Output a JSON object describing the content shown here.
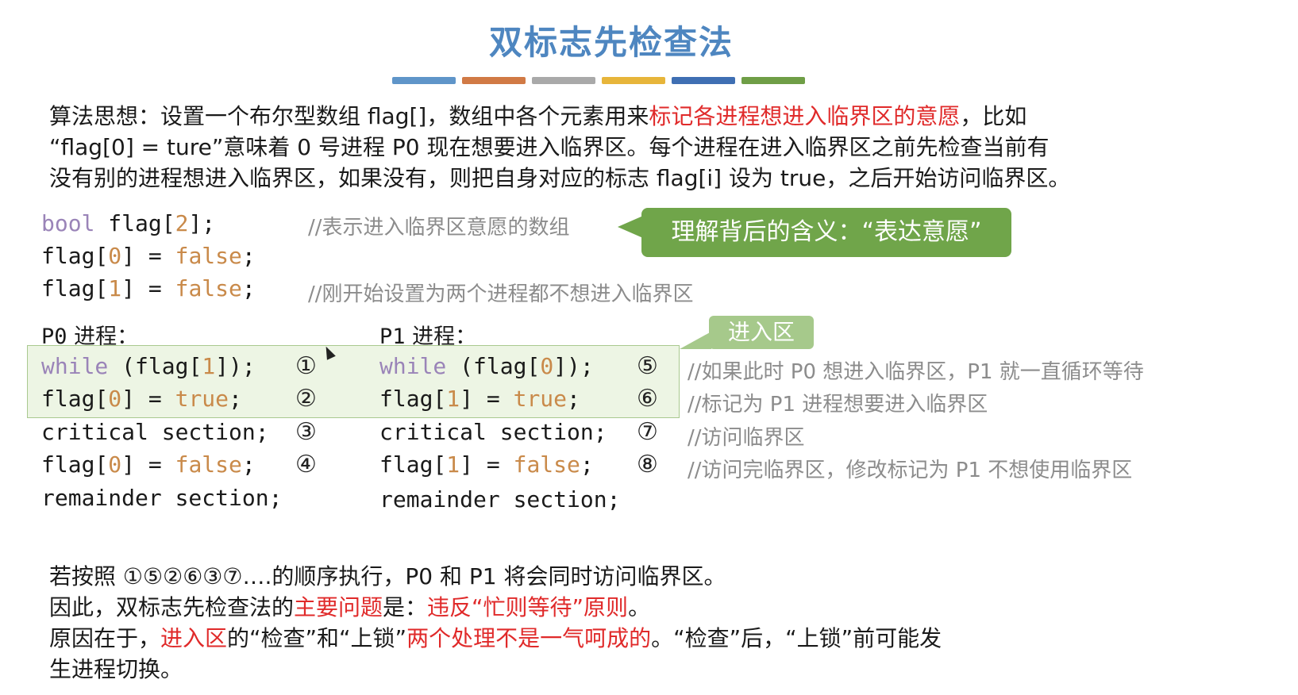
{
  "title": "双标志先检查法",
  "divider_colors": [
    "#5f95c9",
    "#d17a45",
    "#a9a9a9",
    "#e7b53a",
    "#3f6fb3",
    "#6f9e46"
  ],
  "intro": {
    "p1": "算法思想：设置一个布尔型数组 flag[]，数组中各个元素用来",
    "p1_red": "标记各进程想进入临界区的意愿",
    "p1_end": "，比如",
    "p2": "“flag[0] = ture”意味着 0 号进程 P0 现在想要进入临界区。每个进程在进入临界区之前先检查当前有",
    "p3": "没有别的进程想进入临界区，如果没有，则把自身对应的标志 flag[i] 设为 true，之后开始访问临界区。"
  },
  "code_decl": {
    "line1_kw": "bool",
    "line1_rest": " flag[",
    "line1_num": "2",
    "line1_end": "];",
    "line1_comment": "//表示进入临界区意愿的数组",
    "line2_a": "flag[",
    "line2_num": "0",
    "line2_b": "] = ",
    "line2_val": "false",
    "line2_c": ";",
    "line3_a": "flag[",
    "line3_num": "1",
    "line3_b": "] = ",
    "line3_val": "false",
    "line3_c": ";",
    "line3_comment": "//刚开始设置为两个进程都不想进入临界区"
  },
  "callout": "理解背后的含义：“表达意愿”",
  "entry_tag": "进入区",
  "p0": {
    "label_code": "P0",
    "label_cn": " 进程：",
    "l1_kw": "while",
    "l1_a": " (flag[",
    "l1_num": "1",
    "l1_b": "]);",
    "l1_step": "①",
    "l2_a": "flag[",
    "l2_num": "0",
    "l2_b": "] = ",
    "l2_val": "true",
    "l2_c": ";",
    "l2_step": "②",
    "l3": "critical section;",
    "l3_step": "③",
    "l4_a": "flag[",
    "l4_num": "0",
    "l4_b": "] = ",
    "l4_val": "false",
    "l4_c": ";",
    "l4_step": "④",
    "l5": "remainder section;"
  },
  "p1": {
    "label_code": "P1",
    "label_cn": " 进程：",
    "l1_kw": "while",
    "l1_a": " (flag[",
    "l1_num": "0",
    "l1_b": "]);",
    "l1_step": "⑤",
    "l2_a": "flag[",
    "l2_num": "1",
    "l2_b": "] = ",
    "l2_val": "true",
    "l2_c": ";",
    "l2_step": "⑥",
    "l3": "critical section;",
    "l3_step": "⑦",
    "l4_a": "flag[",
    "l4_num": "1",
    "l4_b": "] = ",
    "l4_val": "false",
    "l4_c": ";",
    "l4_step": "⑧",
    "l5": "remainder section;"
  },
  "comments": {
    "c1": "//如果此时 P0 想进入临界区，P1 就一直循环等待",
    "c2": "//标记为 P1 进程想要进入临界区",
    "c3": "//访问临界区",
    "c4": "//访问完临界区，修改标记为 P1 不想使用临界区"
  },
  "conclusion": {
    "l1": "若按照 ①⑤②⑥③⑦….的顺序执行，P0 和 P1 将会同时访问临界区。",
    "l2_a": "因此，双标志先检查法的",
    "l2_red1": "主要问题",
    "l2_b": "是：",
    "l2_red2": "违反“忙则等待”原则",
    "l2_c": "。",
    "l3_a": "原因在于，",
    "l3_red1": "进入区",
    "l3_b": "的“检查”和“上锁”",
    "l3_red2": "两个处理不是一气呵成的",
    "l3_c": "。“检查”后，“上锁”前可能发",
    "l4": "生进程切换。"
  }
}
